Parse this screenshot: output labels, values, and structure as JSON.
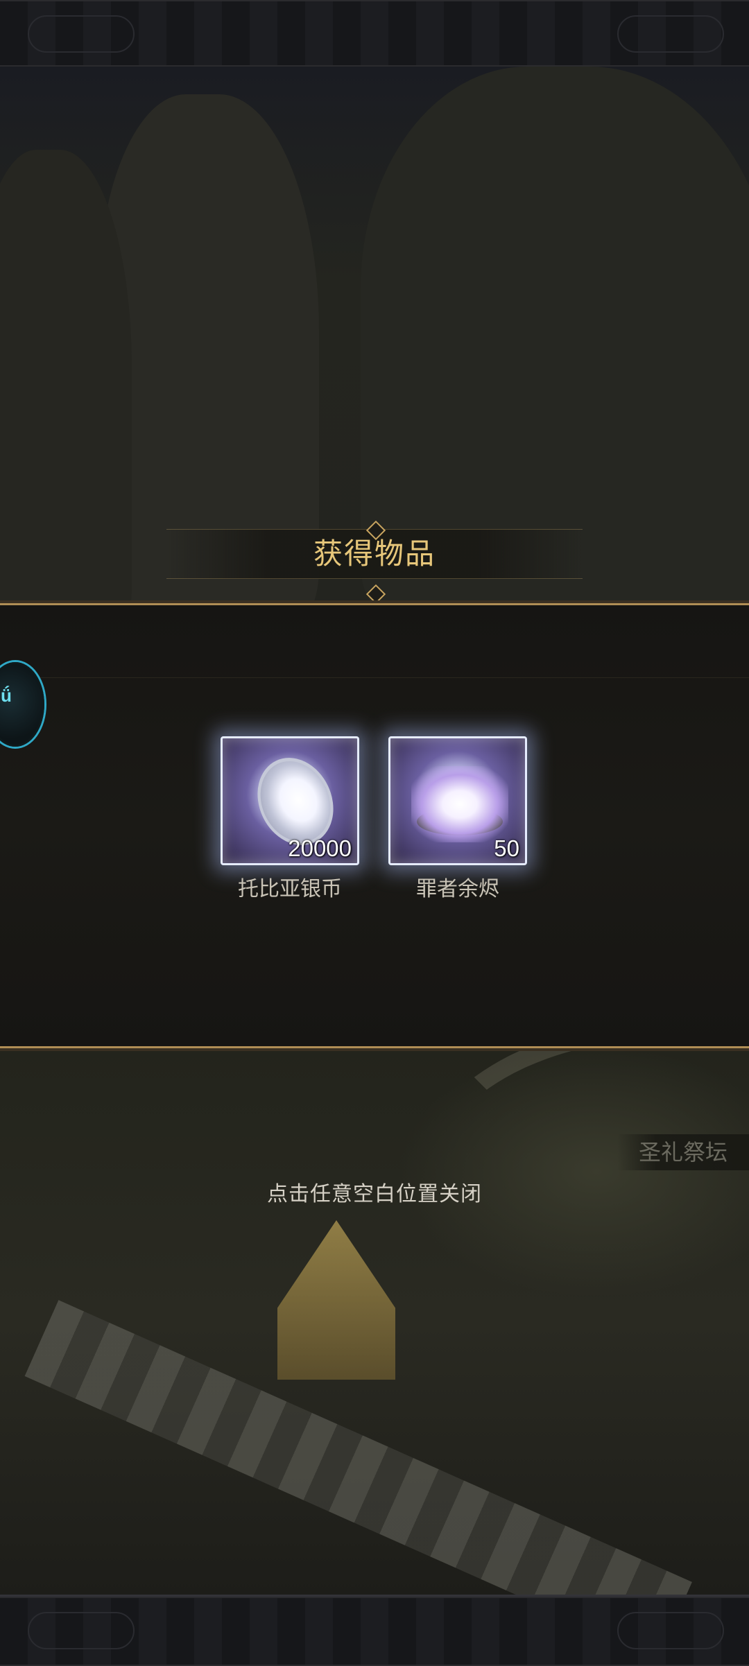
{
  "dialog": {
    "title": "获得物品",
    "close_hint": "点击任意空白位置关闭"
  },
  "items": [
    {
      "name": "托比亚银币",
      "quantity": "20000",
      "icon": "silver-coin-icon"
    },
    {
      "name": "罪者余烬",
      "quantity": "50",
      "icon": "ember-icon"
    }
  ],
  "scene": {
    "location_label": "圣礼祭坛"
  },
  "colors": {
    "title_gold": "#e7c77a",
    "panel_border": "#b08e55",
    "card_glow": "#e6ecff"
  }
}
